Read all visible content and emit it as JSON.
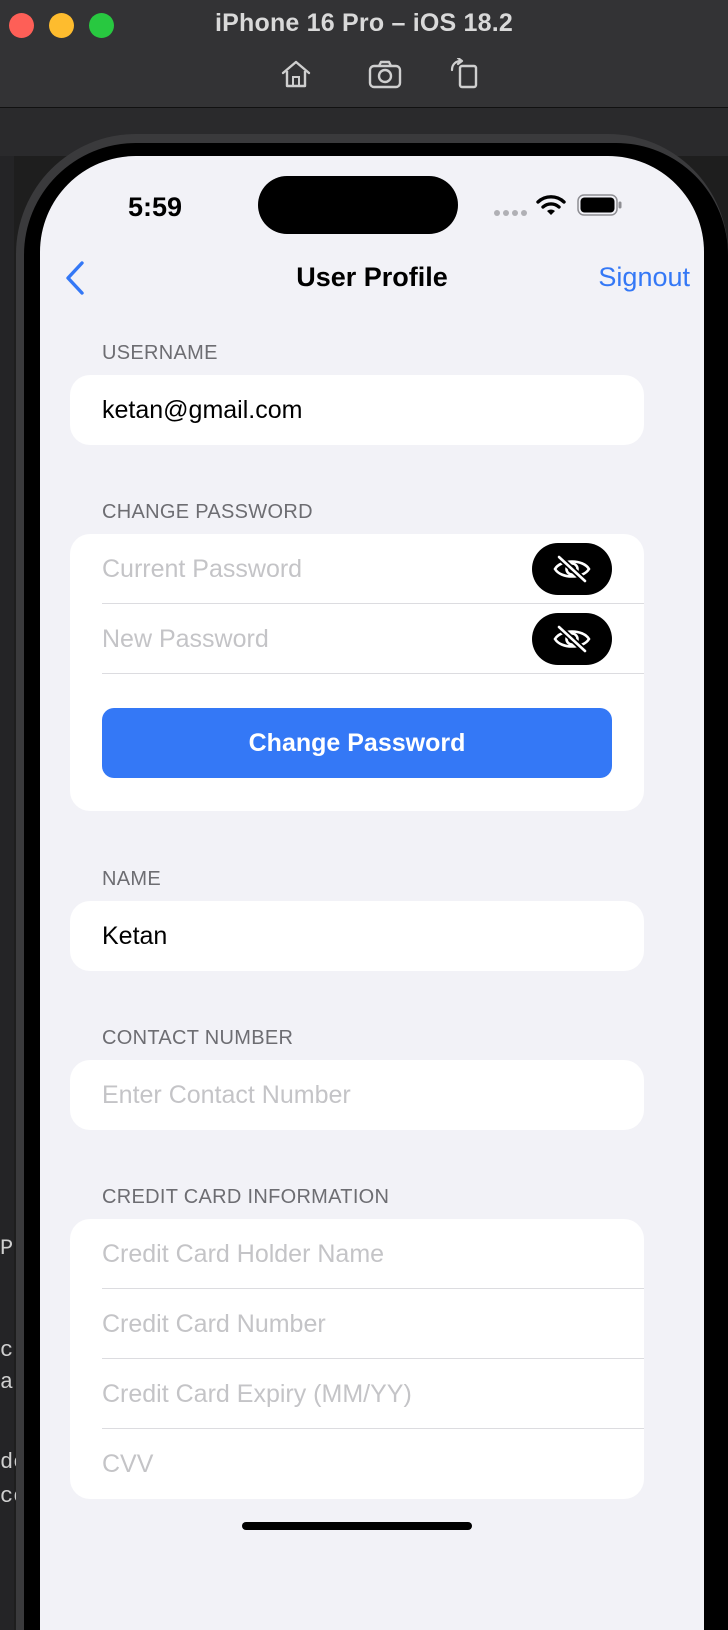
{
  "window": {
    "title": "iPhone 16 Pro – iOS 18.2",
    "tools": [
      "home-icon",
      "screenshot-icon",
      "rotate-icon"
    ]
  },
  "background_fragments": [
    "P",
    "c",
    "a",
    "de",
    "co"
  ],
  "status_bar": {
    "time": "5:59"
  },
  "nav": {
    "title": "User Profile",
    "right_action": "Signout",
    "accent": "#3478f6"
  },
  "sections": {
    "username": {
      "header": "USERNAME",
      "value": "ketan@gmail.com"
    },
    "change_password": {
      "header": "CHANGE PASSWORD",
      "current_placeholder": "Current Password",
      "new_placeholder": "New Password",
      "button_label": "Change Password"
    },
    "name": {
      "header": "NAME",
      "value": "Ketan"
    },
    "contact": {
      "header": "CONTACT NUMBER",
      "placeholder": "Enter Contact Number"
    },
    "credit_card": {
      "header": "CREDIT CARD INFORMATION",
      "holder_placeholder": "Credit Card Holder Name",
      "number_placeholder": "Credit Card Number",
      "expiry_placeholder": "Credit Card Expiry (MM/YY)",
      "cvv_placeholder": "CVV"
    }
  }
}
